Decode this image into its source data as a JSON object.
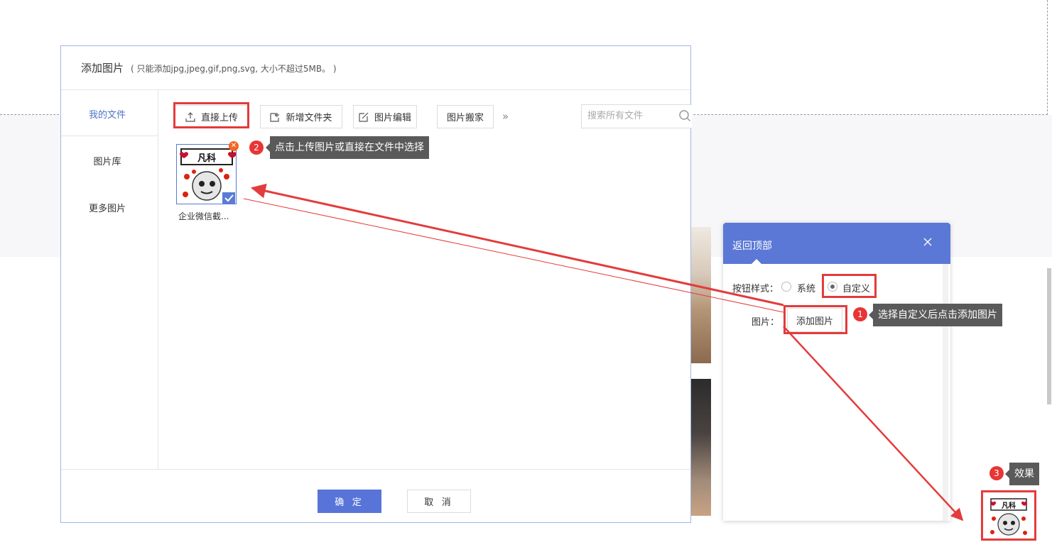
{
  "dialog": {
    "title": "添加图片",
    "hint": "( 只能添加jpg,jpeg,gif,png,svg, 大小不超过5MB。 )",
    "sidebar": [
      "我的文件",
      "图片库",
      "更多图片"
    ],
    "toolbar": {
      "upload": "直接上传",
      "new_folder": "新增文件夹",
      "edit": "图片编辑",
      "move": "图片搬家",
      "search_placeholder": "搜索所有文件"
    },
    "file": {
      "name": "企业微信截...",
      "stamp_text": "凡科",
      "selected": true
    },
    "ok_label": "确 定",
    "cancel_label": "取 消"
  },
  "panel": {
    "title": "返回顶部",
    "style_label": "按钮样式：",
    "option_system": "系统",
    "option_custom": "自定义",
    "selected_option": "自定义",
    "image_label": "图片：",
    "add_image_label": "添加图片"
  },
  "annotations": [
    {
      "num": "1",
      "text": "选择自定义后点击添加图片"
    },
    {
      "num": "2",
      "text": "点击上传图片或直接在文件中选择"
    },
    {
      "num": "3",
      "text": "效果"
    }
  ],
  "colors": {
    "accent": "#5874d8",
    "annotation": "#e43b3b",
    "tooltip": "#5a5a5a"
  }
}
